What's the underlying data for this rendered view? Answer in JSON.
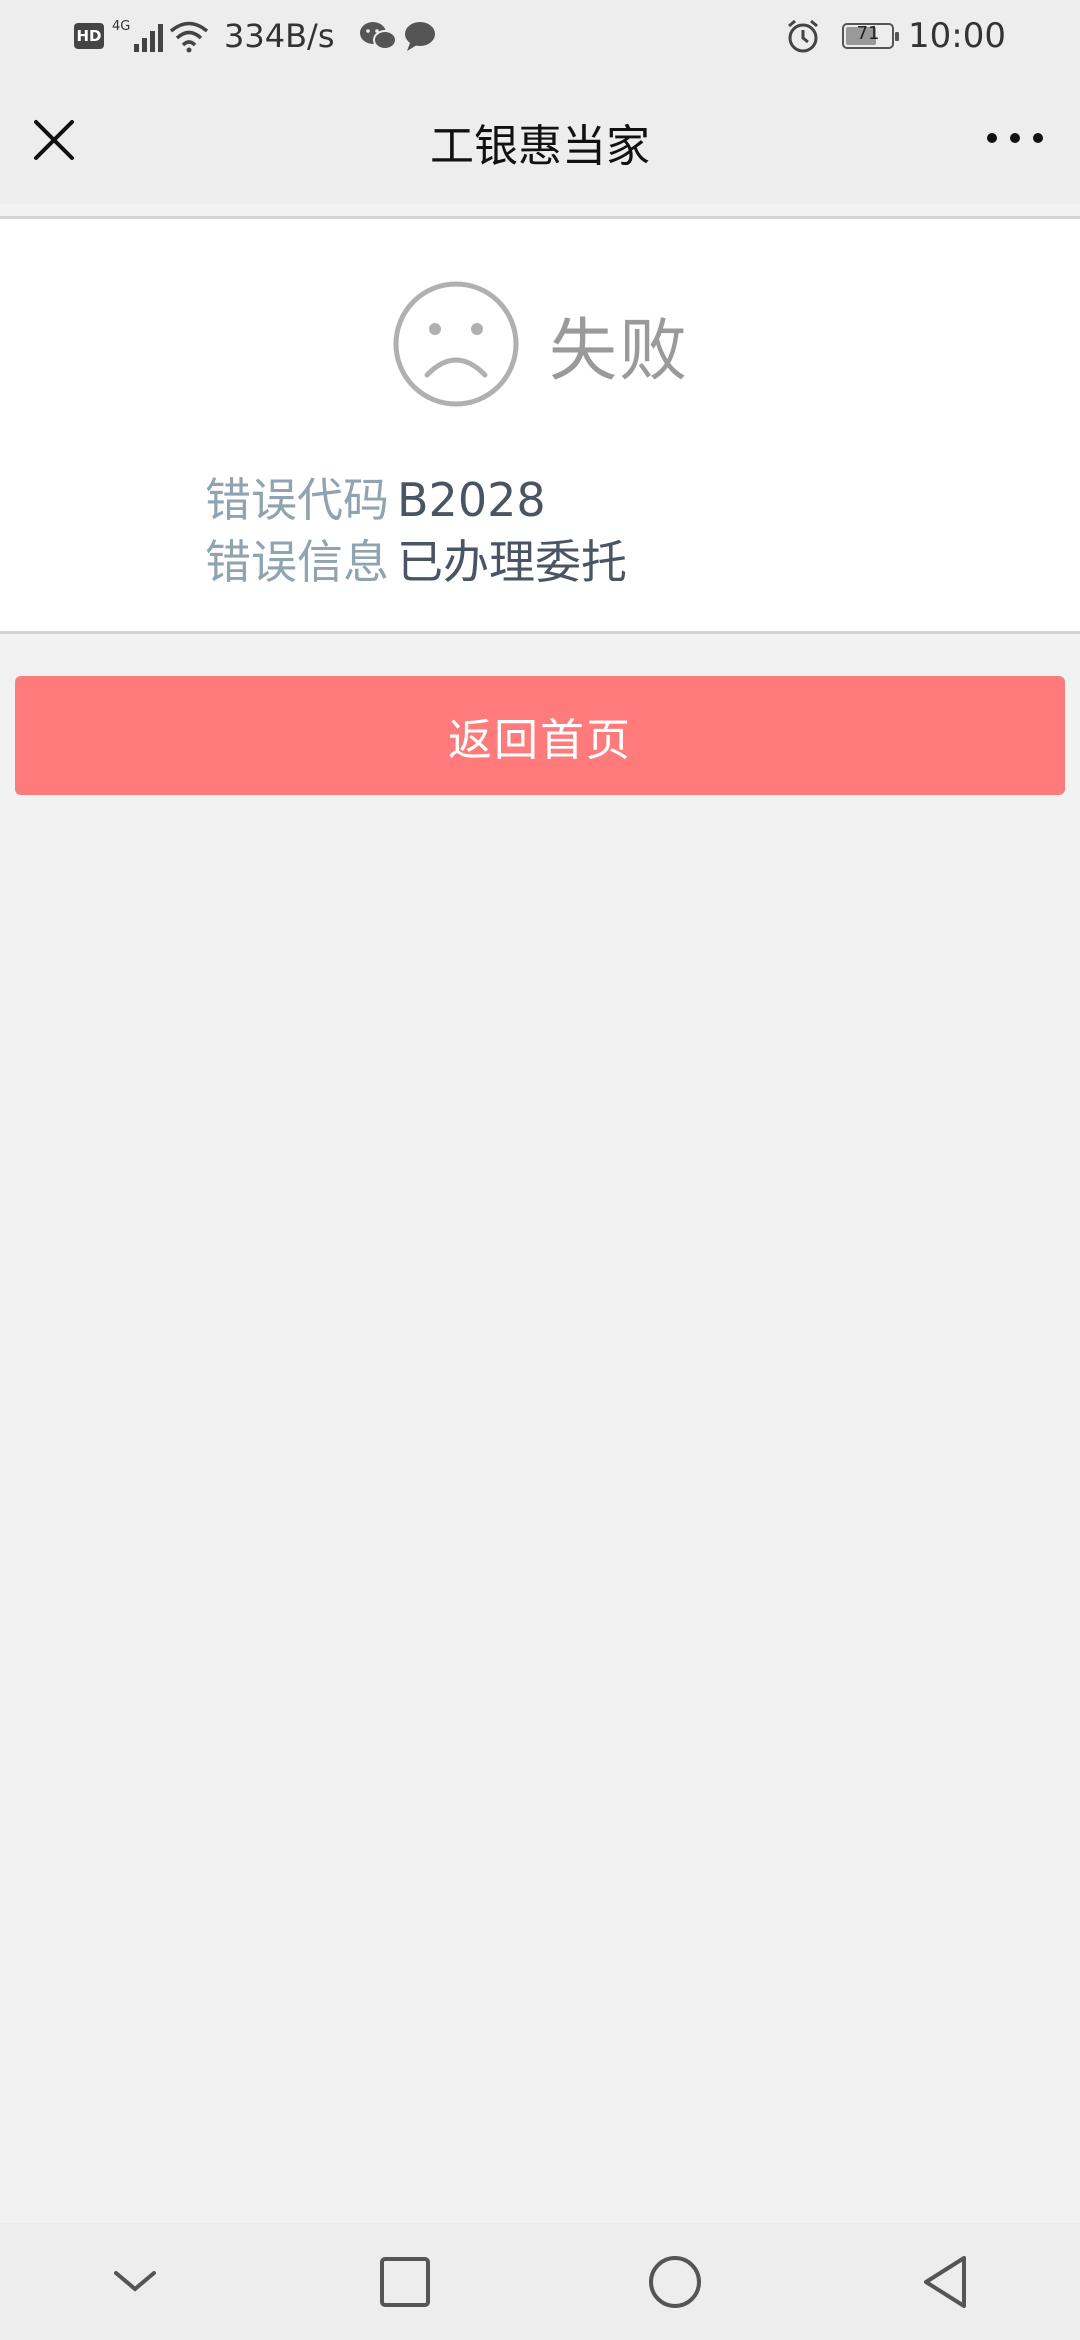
{
  "status_bar": {
    "hd": "HD",
    "network": "4G",
    "speed": "334B/s",
    "battery": "71",
    "time": "10:00",
    "icons": [
      "signal-icon",
      "wifi-icon",
      "wechat-icon",
      "message-icon",
      "alarm-icon",
      "battery-icon"
    ]
  },
  "navbar": {
    "title": "工银惠当家",
    "close_icon": "close-icon",
    "more_icon": "more-icon"
  },
  "result": {
    "status": "失败",
    "icon": "sad-face-icon",
    "error_code_label": "错误代码",
    "error_code": "B2028",
    "error_msg_label": "错误信息",
    "error_msg": "已办理委托"
  },
  "actions": {
    "back_home_label": "返回首页"
  },
  "system_nav": {
    "icons": [
      "chevron-down-icon",
      "square-icon",
      "circle-icon",
      "back-triangle-icon"
    ]
  },
  "colors": {
    "button": "#ff7a7a",
    "label": "#8fa4b0",
    "value": "#4a5563",
    "status": "#9a9a9a",
    "background": "#f2f2f2"
  }
}
